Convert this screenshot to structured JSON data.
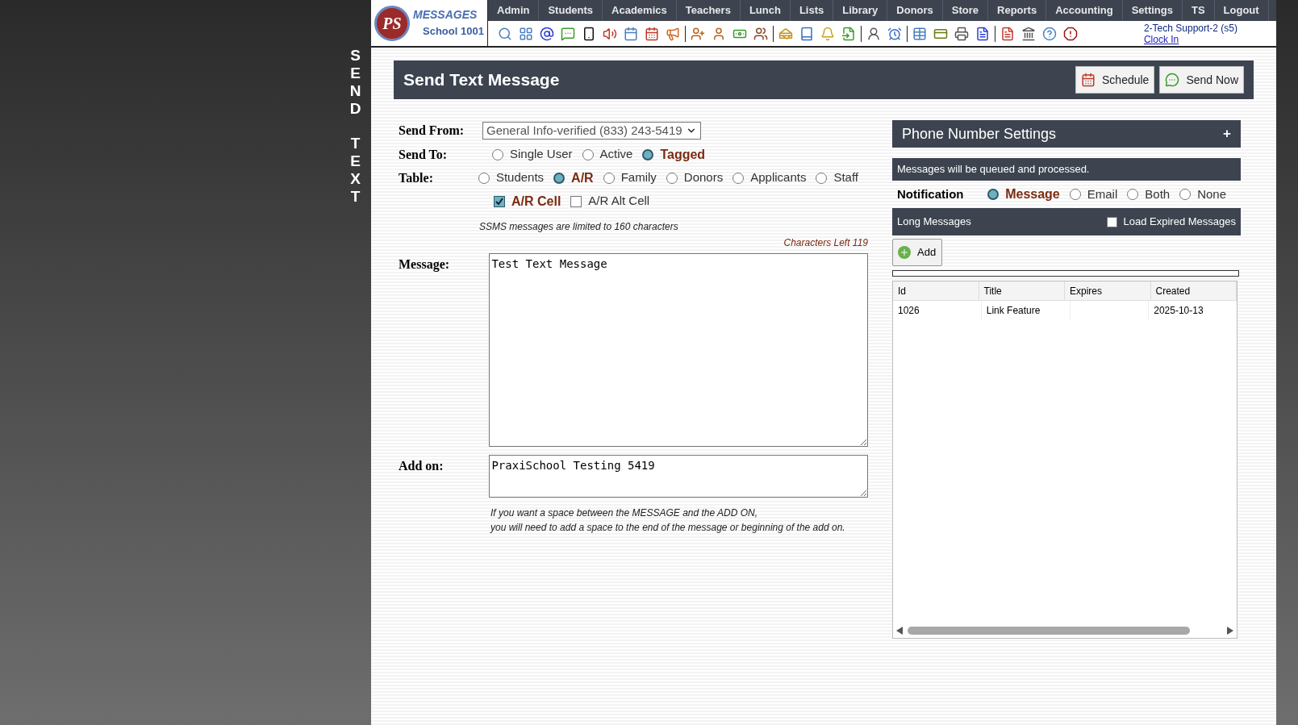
{
  "logo": {
    "mark": "PS",
    "title": "MESSAGES",
    "subtitle": "School 1001"
  },
  "nav": [
    "Admin",
    "Students",
    "Academics",
    "Teachers",
    "Lunch",
    "Lists",
    "Library",
    "Donors",
    "Store",
    "Reports",
    "Accounting",
    "Settings",
    "TS",
    "Logout"
  ],
  "user": {
    "name": "2-Tech Support-2 (s5)",
    "link": "Clock In"
  },
  "side_label": "SEND TEXT",
  "page_title": "Send Text Message",
  "header_buttons": [
    {
      "label": "Schedule",
      "kind": "calendar"
    },
    {
      "label": "Send Now",
      "kind": "chat"
    }
  ],
  "form": {
    "send_from": {
      "label": "Send From:",
      "value": "General Info-verified (833) 243-5419"
    },
    "send_to": {
      "label": "Send To:",
      "options": [
        {
          "label": "Single User",
          "selected": false
        },
        {
          "label": "Active",
          "selected": false
        },
        {
          "label": "Tagged",
          "selected": true
        }
      ]
    },
    "table": {
      "label": "Table:",
      "options": [
        {
          "label": "Students",
          "selected": false
        },
        {
          "label": "A/R",
          "selected": true
        },
        {
          "label": "Family",
          "selected": false
        },
        {
          "label": "Donors",
          "selected": false
        },
        {
          "label": "Applicants",
          "selected": false
        },
        {
          "label": "Staff",
          "selected": false
        }
      ],
      "checkboxes": [
        {
          "label": "A/R Cell",
          "checked": true
        },
        {
          "label": "A/R Alt Cell",
          "checked": false
        }
      ]
    },
    "limit_note": "SSMS messages are limited to 160 characters",
    "chars_left": "Characters Left 119",
    "message": {
      "label": "Message:",
      "value": "Test Text Message"
    },
    "add_on": {
      "label": "Add on:",
      "value": "PraxiSchool Testing 5419"
    },
    "hint_lines": [
      "If you want a space between the MESSAGE and the ADD ON,",
      "you will need to add a space to the end of the message or beginning of the add on."
    ]
  },
  "settings": {
    "title": "Phone Number Settings",
    "toggle": "+",
    "info": "Messages will be queued and processed.",
    "notification": {
      "label": "Notification",
      "options": [
        {
          "label": "Message",
          "selected": true
        },
        {
          "label": "Email",
          "selected": false
        },
        {
          "label": "Both",
          "selected": false
        },
        {
          "label": "None",
          "selected": false
        }
      ]
    },
    "long_messages": {
      "title": "Long Messages",
      "load_expired": {
        "label": "Load Expired Messages",
        "checked": false
      }
    },
    "add_button": "Add",
    "table": {
      "columns": [
        "Id",
        "Title",
        "Expires",
        "Created"
      ],
      "rows": [
        {
          "id": "1026",
          "title": "Link Feature",
          "created": "2025-10-13"
        }
      ]
    }
  }
}
